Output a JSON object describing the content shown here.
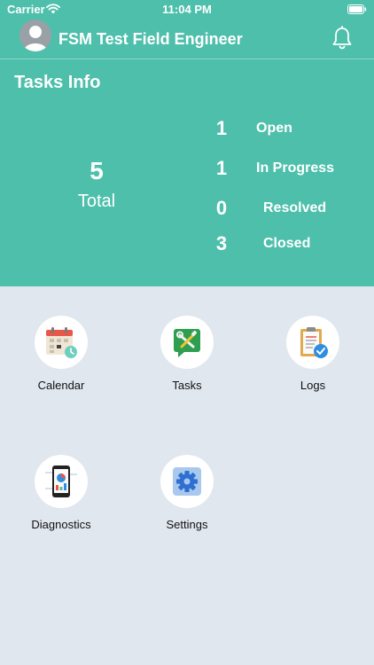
{
  "status_bar": {
    "carrier": "Carrier",
    "time": "11:04 PM"
  },
  "header": {
    "title": "FSM Test Field Engineer"
  },
  "tasks_info": {
    "title": "Tasks Info",
    "total": {
      "count": "5",
      "label": "Total"
    },
    "stats": [
      {
        "count": "1",
        "label": "Open"
      },
      {
        "count": "1",
        "label": "In Progress"
      },
      {
        "count": "0",
        "label": "Resolved"
      },
      {
        "count": "3",
        "label": "Closed"
      }
    ]
  },
  "menu": [
    {
      "label": "Calendar",
      "icon": "calendar-icon"
    },
    {
      "label": "Tasks",
      "icon": "tasks-icon"
    },
    {
      "label": "Logs",
      "icon": "logs-icon"
    },
    {
      "label": "Diagnostics",
      "icon": "diagnostics-icon"
    },
    {
      "label": "Settings",
      "icon": "settings-icon"
    }
  ],
  "colors": {
    "header_background": "#4ebfab",
    "page_background": "#e1e7ef",
    "text_light": "#ffffff",
    "text_dark": "#111111"
  }
}
